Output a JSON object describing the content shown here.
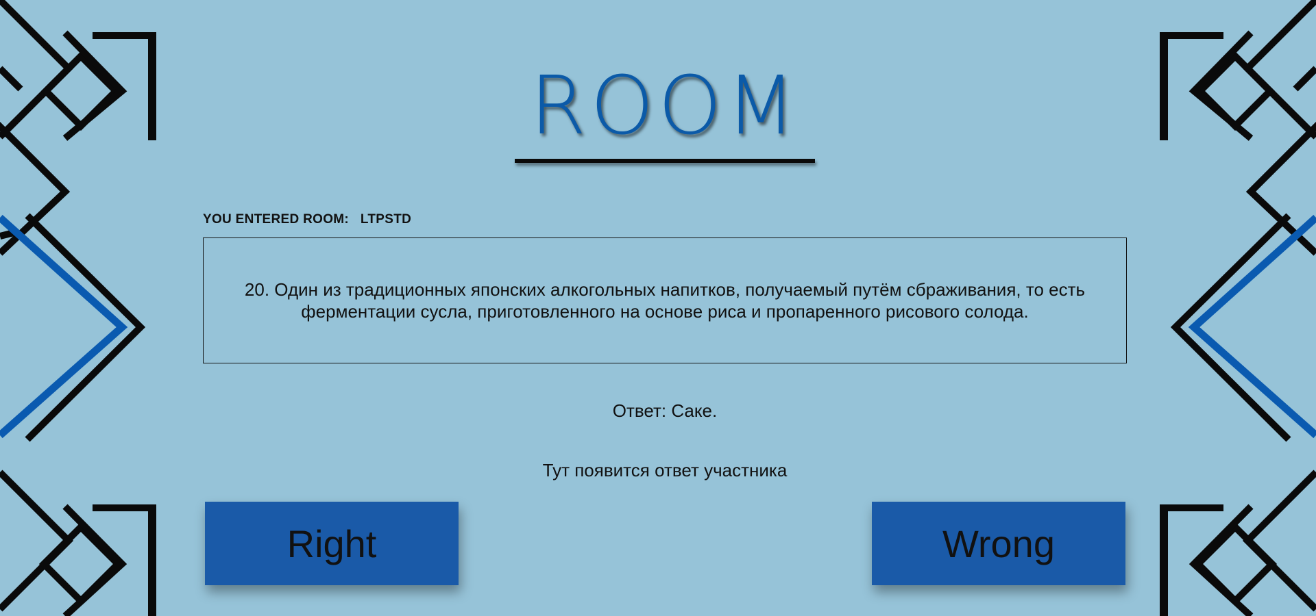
{
  "header": {
    "title": "ROOM"
  },
  "room": {
    "label": "YOU ENTERED ROOM:",
    "code": "LTPSTD"
  },
  "question": {
    "text": "20. Один из традиционных японских алкогольных напитков, получаемый путём сбраживания, то есть ферментации сусла, приготовленного на основе риса и пропаренного рисового солода."
  },
  "answer": {
    "text": "Ответ: Саке."
  },
  "participant": {
    "placeholder_text": "Тут появится ответ участника"
  },
  "buttons": {
    "right_label": "Right",
    "wrong_label": "Wrong"
  },
  "colors": {
    "background": "#96c3d8",
    "accent_blue": "#0b5aa8",
    "button_blue": "#1a5aa8",
    "ornament_black": "#0a0a0a"
  },
  "icons": {
    "left_ornament": "geometric-diamond-ornament",
    "right_ornament": "geometric-diamond-ornament"
  }
}
